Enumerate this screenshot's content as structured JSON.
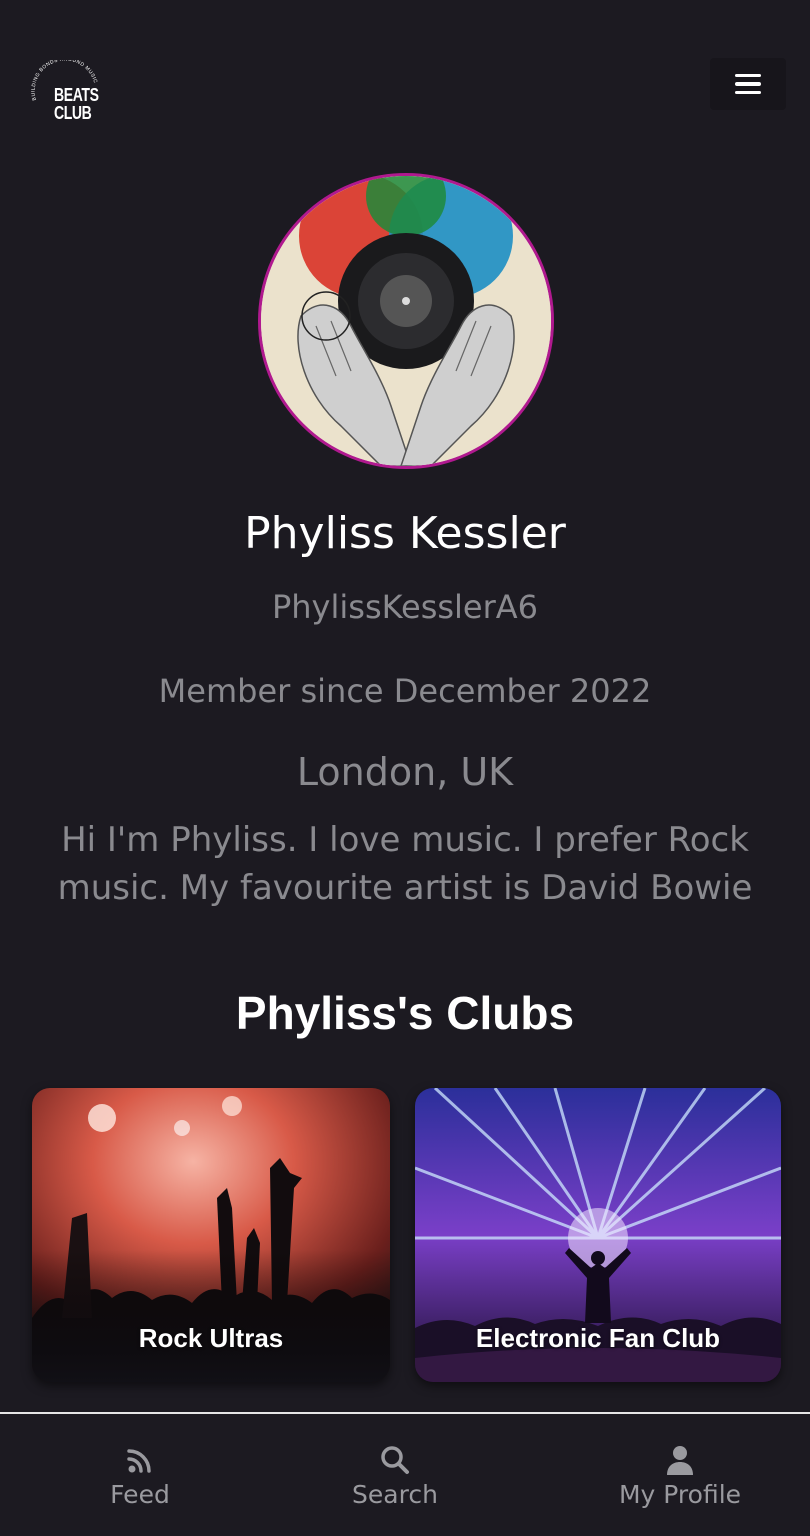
{
  "header": {
    "logo_text": "BEATS CLUB",
    "logo_tagline": "BUILDING BONDS AROUND MUSIC!",
    "menu_icon": "hamburger-icon"
  },
  "profile": {
    "name": "Phyliss Kessler",
    "username": "PhylissKesslerA6",
    "member_since": "Member since December 2022",
    "location": "London, UK",
    "bio": "Hi I'm Phyliss. I love music. I prefer Rock music. My favourite artist is David Bowie",
    "avatar_border_color": "#b0198f"
  },
  "clubs": {
    "title": "Phyliss's Clubs",
    "items": [
      {
        "name": "Rock Ultras"
      },
      {
        "name": "Electronic Fan Club"
      }
    ]
  },
  "bottom_nav": {
    "items": [
      {
        "label": "Feed",
        "icon": "rss-icon"
      },
      {
        "label": "Search",
        "icon": "search-icon"
      },
      {
        "label": "My Profile",
        "icon": "user-icon"
      }
    ]
  },
  "colors": {
    "background": "#1c1a21",
    "muted_text": "#8a8a8f",
    "accent": "#b0198f"
  }
}
